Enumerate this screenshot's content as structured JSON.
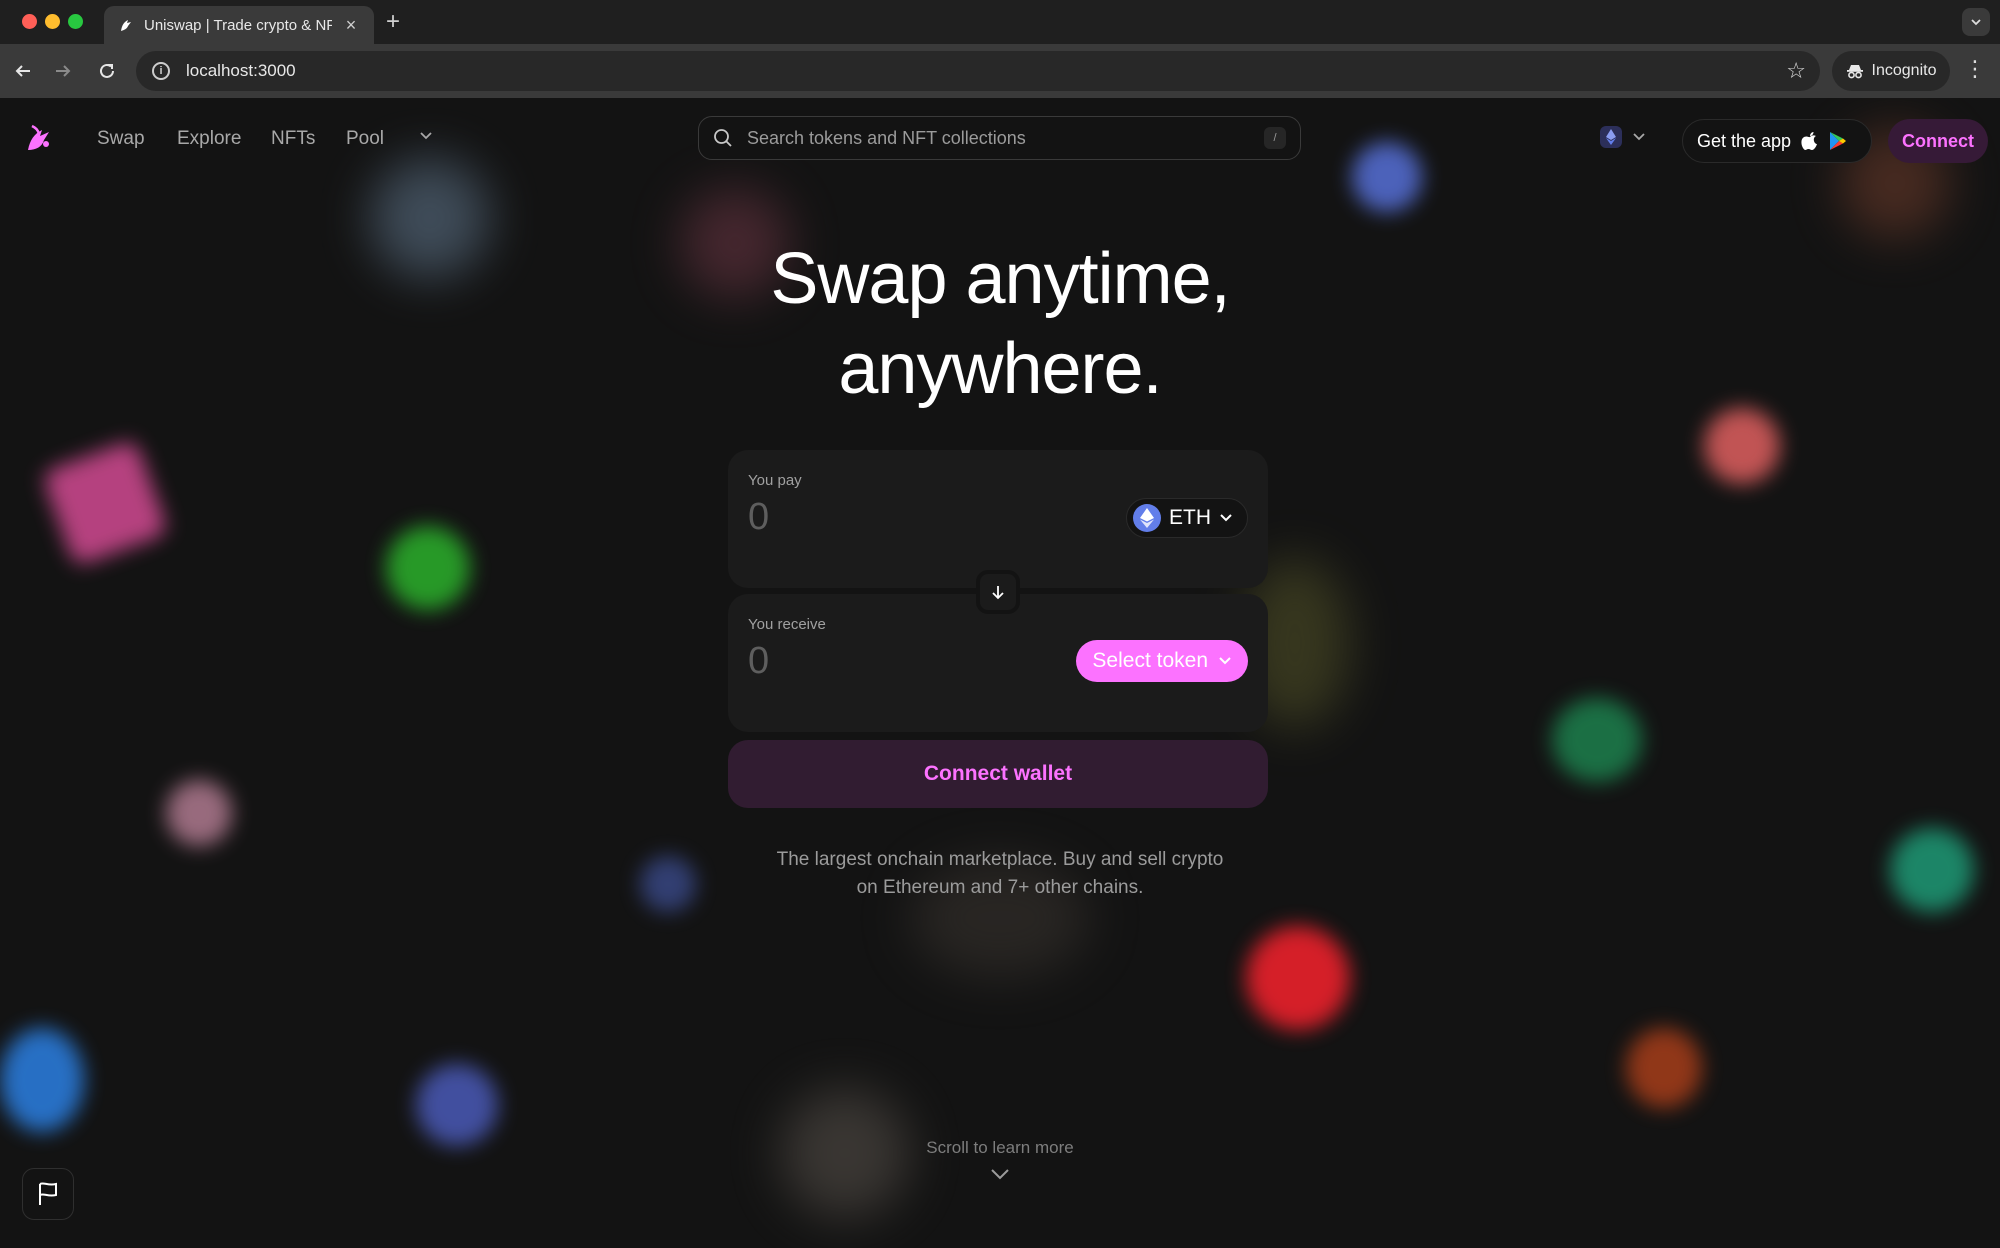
{
  "browser": {
    "tab_title": "Uniswap | Trade crypto & NFTs",
    "tab_close": "×",
    "new_tab": "+",
    "url": "localhost:3000",
    "incognito_label": "Incognito"
  },
  "nav": {
    "links": [
      "Swap",
      "Explore",
      "NFTs",
      "Pool"
    ],
    "search_placeholder": "Search tokens and NFT collections",
    "search_shortcut": "/",
    "get_app_label": "Get the app",
    "connect_label": "Connect"
  },
  "hero": {
    "line1": "Swap anytime,",
    "line2": "anywhere."
  },
  "swap": {
    "pay_label": "You pay",
    "pay_amount_placeholder": "0",
    "pay_token": "ETH",
    "receive_label": "You receive",
    "receive_amount_placeholder": "0",
    "select_token_label": "Select token",
    "connect_wallet_label": "Connect wallet"
  },
  "tagline": {
    "line1": "The largest onchain marketplace. Buy and sell crypto",
    "line2": "on Ethereum and 7+ other chains."
  },
  "footer": {
    "scroll_label": "Scroll to learn more"
  },
  "colors": {
    "accent": "#fc72ff",
    "background": "#131313",
    "panel": "#1b1b1b",
    "eth": "#627eea"
  }
}
